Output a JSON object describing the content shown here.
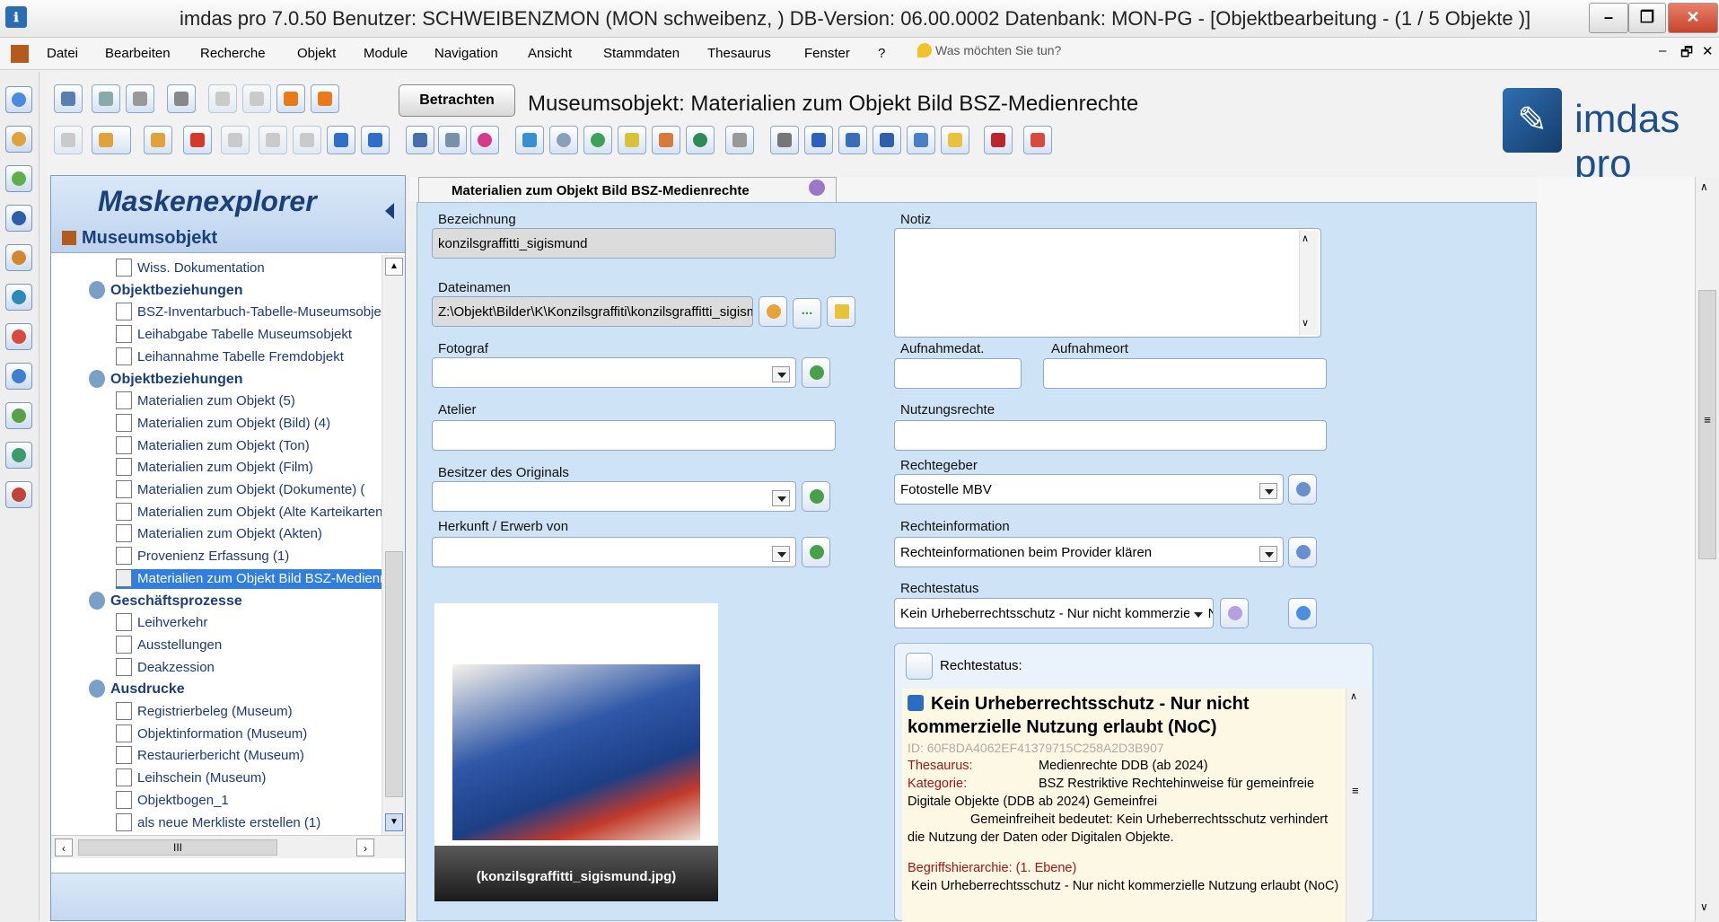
{
  "window": {
    "title": "imdas pro 7.0.50 Benutzer: SCHWEIBENZMON (MON schweibenz, )   DB-Version: 06.00.0002   Datenbank: MON-PG - [Objektbearbeitung - (1 / 5 Objekte )]",
    "minimize": "–",
    "restore": "❐",
    "close": "✕"
  },
  "menu": {
    "items": [
      "Datei",
      "Bearbeiten",
      "Recherche",
      "Objekt",
      "Module",
      "Navigation",
      "Ansicht",
      "Stammdaten",
      "Thesaurus",
      "Fenster",
      "?"
    ],
    "help_placeholder": "Was möchten Sie tun?",
    "mdi_min": "–",
    "mdi_restore": "🗗",
    "mdi_close": "✕"
  },
  "toolbar": {
    "betrachten_label": "Betrachten",
    "page_title": "Museumsobjekt: Materialien zum Objekt Bild BSZ-Medienrechte",
    "logo_text": "imdas pro"
  },
  "explorer": {
    "title": "Maskenexplorer",
    "root": "Museumsobjekt",
    "items": [
      {
        "label": "Wiss. Dokumentation",
        "group": false
      },
      {
        "label": "Objektbeziehungen",
        "group": true
      },
      {
        "label": "BSZ-Inventarbuch-Tabelle-Museumsobjekt",
        "group": false
      },
      {
        "label": "Leihabgabe Tabelle Museumsobjekt",
        "group": false
      },
      {
        "label": "Leihannahme Tabelle Fremdobjekt",
        "group": false
      },
      {
        "label": "Objektbeziehungen",
        "group": true
      },
      {
        "label": "Materialien zum Objekt (5)",
        "group": false
      },
      {
        "label": "Materialien zum Objekt (Bild) (4)",
        "group": false
      },
      {
        "label": "Materialien zum Objekt (Ton)",
        "group": false
      },
      {
        "label": "Materialien zum Objekt (Film)",
        "group": false
      },
      {
        "label": "Materialien zum Objekt (Dokumente) (",
        "group": false
      },
      {
        "label": "Materialien zum Objekt (Alte Karteikarten)",
        "group": false
      },
      {
        "label": "Materialien zum Objekt (Akten)",
        "group": false
      },
      {
        "label": "Provenienz Erfassung (1)",
        "group": false
      },
      {
        "label": "Materialien zum Objekt Bild BSZ-Medienrechte",
        "group": false
      },
      {
        "label": "Geschäftsprozesse",
        "group": true
      },
      {
        "label": "Leihverkehr",
        "group": false
      },
      {
        "label": "Ausstellungen",
        "group": false
      },
      {
        "label": "Deakzession",
        "group": false
      },
      {
        "label": "Ausdrucke",
        "group": true
      },
      {
        "label": "Registrierbeleg (Museum)",
        "group": false
      },
      {
        "label": "Objektinformation (Museum)",
        "group": false
      },
      {
        "label": "Restaurierbericht (Museum)",
        "group": false
      },
      {
        "label": "Leihschein (Museum)",
        "group": false
      },
      {
        "label": "Objektbogen_1",
        "group": false
      },
      {
        "label": "als neue Merkliste erstellen (1)",
        "group": false
      }
    ],
    "selected_index": 14,
    "hscroll_thumb": "III"
  },
  "form": {
    "tab_label": "Materialien zum Objekt Bild BSZ-Medienrechte",
    "bezeichnung_label": "Bezeichnung",
    "bezeichnung_value": "konzilsgraffitti_sigismund",
    "dateinamen_label": "Dateinamen",
    "dateinamen_value": "Z:\\Objekt\\Bilder\\K\\Konzilsgraffiti\\konzilsgraffitti_sigismund.jpg",
    "fotograf_label": "Fotograf",
    "atelier_label": "Atelier",
    "besitzer_label": "Besitzer des Originals",
    "herkunft_label": "Herkunft / Erwerb von",
    "notiz_label": "Notiz",
    "aufnahmedat_label": "Aufnahmedat.",
    "aufnahmeort_label": "Aufnahmeort",
    "nutzungsrechte_label": "Nutzungsrechte",
    "rechtegeber_label": "Rechtegeber",
    "rechtegeber_value": "Fotostelle MBV",
    "rechteinfo_label": "Rechteinformation",
    "rechteinfo_value": "Rechteinformationen beim Provider klären",
    "rechtestatus_label": "Rechtestatus",
    "rechtestatus_value": "Kein Urheberrechtsschutz - Nur nicht kommerzielle Nutzung erlaubt (NoC)",
    "photo_caption": "(konzilsgraffitti_sigismund.jpg)",
    "dots_button": "..."
  },
  "rechtestatus_box": {
    "header": "Rechtestatus:",
    "title": "Kein Urheberrechtsschutz - Nur nicht kommerzielle Nutzung erlaubt (NoC)",
    "id": "ID: 60F8DA4062EF41379715C258A2D3B907",
    "thesaurus_label": "Thesaurus:",
    "thesaurus_value": "Medienrechte DDB (ab 2024)",
    "kategorie_label": "Kategorie:",
    "kategorie_value": "BSZ Restriktive Rechtehinweise für gemeinfreie Digitale Objekte (DDB ab 2024)          Gemeinfrei",
    "description": "Gemeinfreiheit bedeutet: Kein Urheberrechtsschutz verhindert die Nutzung der Daten oder Digitalen Objekte.",
    "hierarchy_label": "Begriffshierarchie: (1. Ebene)",
    "hierarchy_value": "Kein Urheberrechtsschutz - Nur nicht kommerzielle Nutzung erlaubt (NoC)"
  },
  "colors": {
    "form_bg": "#cfe3f6",
    "explorer_head": "#bcd3ee",
    "selection": "#2f7ee0",
    "info_bg": "#fdf8e4"
  }
}
